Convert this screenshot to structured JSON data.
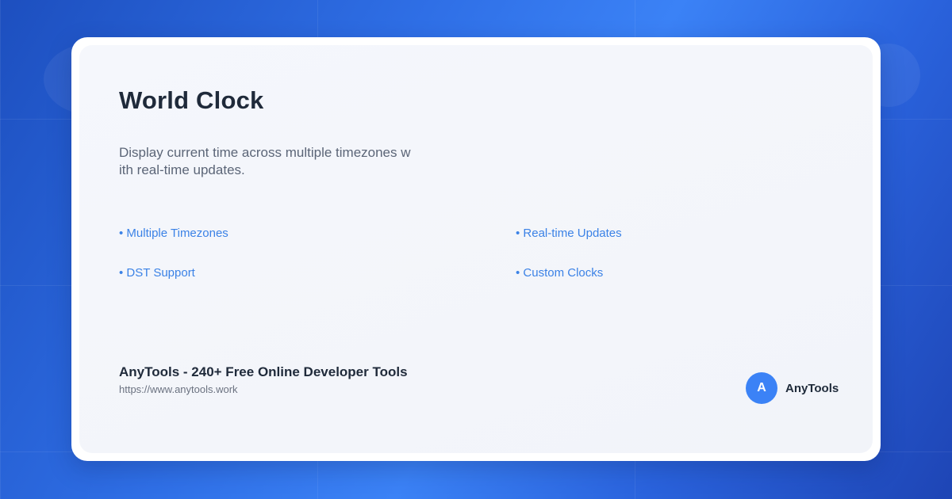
{
  "card": {
    "title": "World Clock",
    "description": "Display current time across multiple timezones with real-time updates."
  },
  "features": [
    "• Multiple Timezones",
    "• Real-time Updates",
    "• DST Support",
    "• Custom Clocks"
  ],
  "footer": {
    "site_title": "AnyTools - 240+ Free Online Developer Tools",
    "url": "https://www.anytools.work"
  },
  "brand": {
    "avatar_letter": "A",
    "name": "AnyTools"
  },
  "colors": {
    "accent": "#3b82f6",
    "feature_text": "#3b82e6",
    "title_text": "#1f2a3a"
  }
}
